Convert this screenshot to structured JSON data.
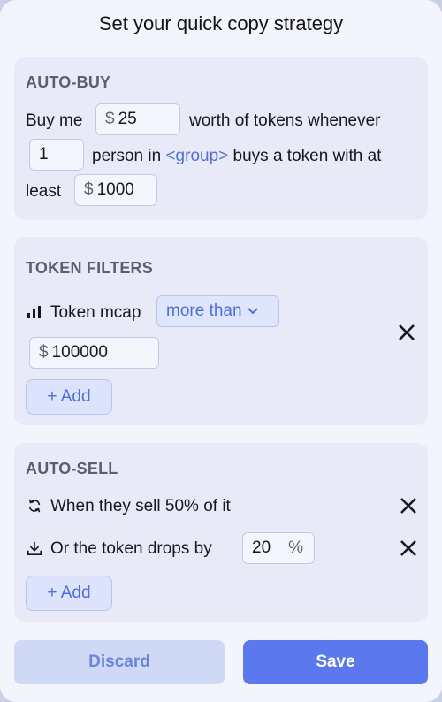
{
  "title": "Set your quick copy strategy",
  "auto_buy": {
    "heading": "AUTO-BUY",
    "text_buy_me": "Buy me",
    "amount_currency": "$",
    "amount_value": "25",
    "text_worth": "worth of tokens whenever",
    "count_value": "1",
    "text_person_in": "person in",
    "group_link": "<group>",
    "text_buys": "buys a token with at",
    "text_least": "least",
    "min_currency": "$",
    "min_value": "1000"
  },
  "token_filters": {
    "heading": "TOKEN FILTERS",
    "filter_icon": "bar-chart-icon",
    "filter_label": "Token mcap",
    "comparator": "more than",
    "value_currency": "$",
    "value": "100000",
    "add_label": "+ Add",
    "remove_icon": "close-icon"
  },
  "auto_sell": {
    "heading": "AUTO-SELL",
    "rule1_icon": "refresh-icon",
    "rule1_text": "When they sell 50% of it",
    "rule2_icon": "download-icon",
    "rule2_text": "Or the token drops by",
    "rule2_value": "20",
    "rule2_unit": "%",
    "add_label": "+ Add",
    "remove_icon": "close-icon"
  },
  "footer": {
    "discard_label": "Discard",
    "save_label": "Save"
  },
  "colors": {
    "accent": "#5c78ee",
    "link": "#4f6fd8",
    "card_bg": "#e8eaf8",
    "panel_bg": "#f4f5fc"
  }
}
